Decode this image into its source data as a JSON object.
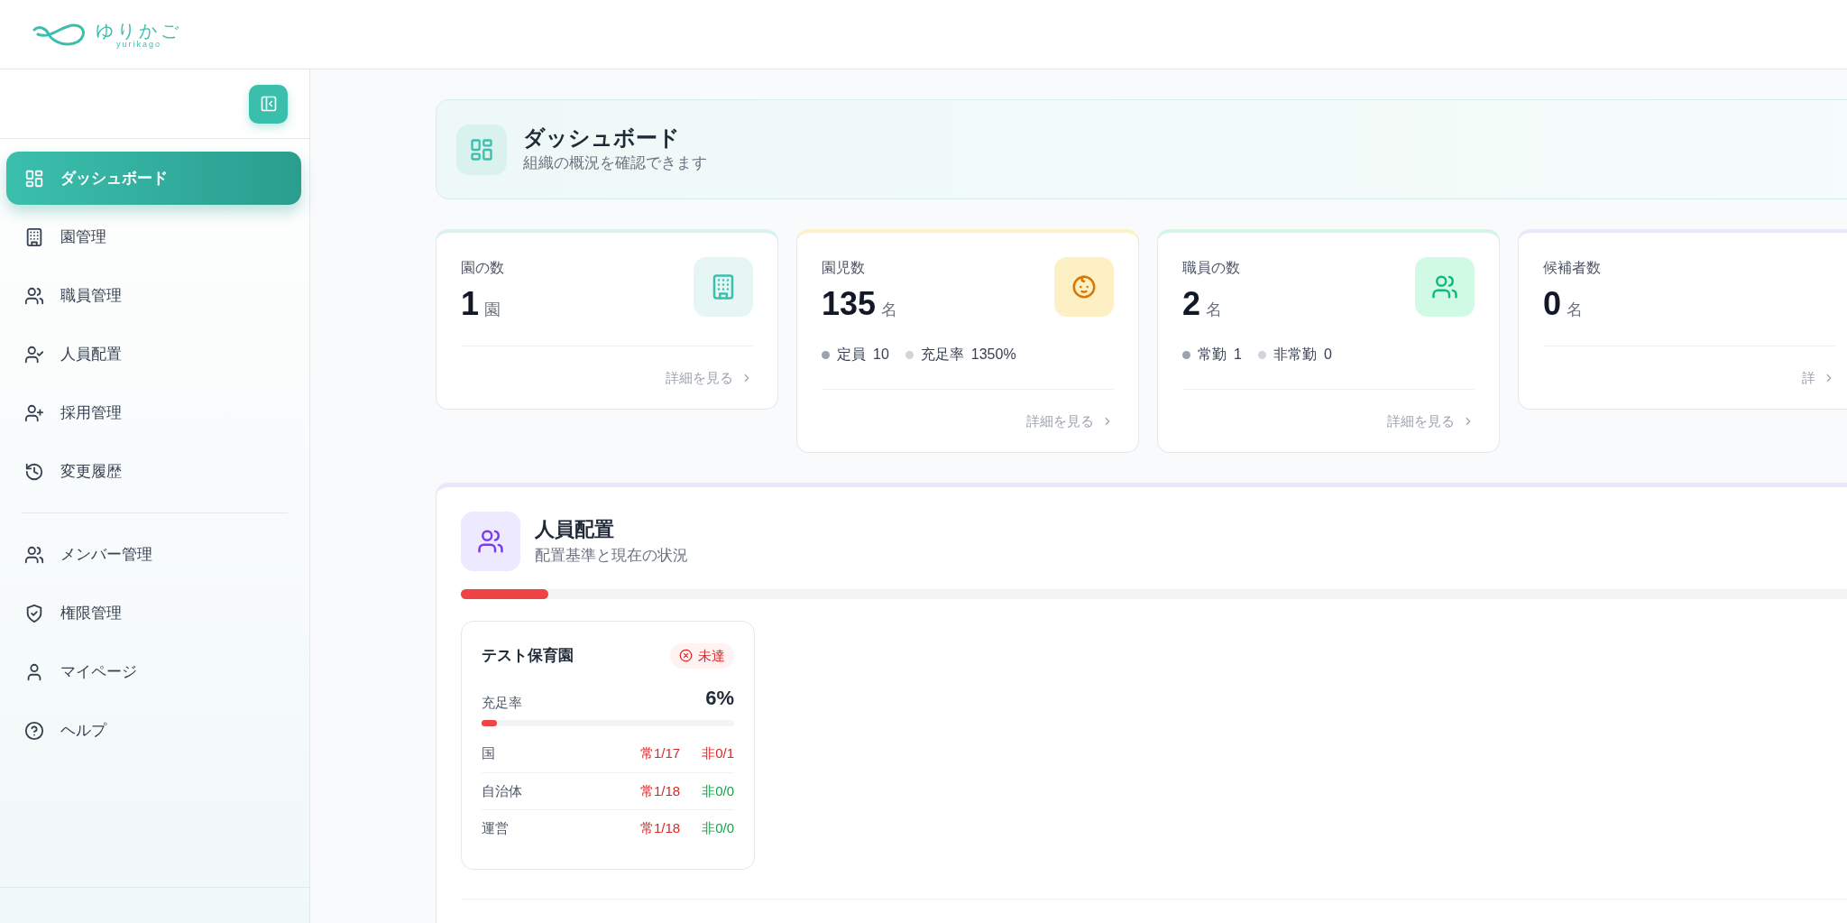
{
  "logo": {
    "name": "ゆりかご",
    "subtitle": "yurikago"
  },
  "sidebar": {
    "groups": [
      {
        "items": [
          {
            "label": "ダッシュボード",
            "selected": true
          },
          {
            "label": "園管理",
            "selected": false
          },
          {
            "label": "職員管理",
            "selected": false
          },
          {
            "label": "人員配置",
            "selected": false
          },
          {
            "label": "採用管理",
            "selected": false
          },
          {
            "label": "変更履歴",
            "selected": false
          }
        ]
      },
      {
        "items": [
          {
            "label": "メンバー管理",
            "selected": false
          },
          {
            "label": "権限管理",
            "selected": false
          },
          {
            "label": "マイページ",
            "selected": false
          },
          {
            "label": "ヘルプ",
            "selected": false
          }
        ]
      }
    ]
  },
  "page_header": {
    "title": "ダッシュボード",
    "subtitle": "組織の概況を確認できます"
  },
  "stat_cards": [
    {
      "label": "園の数",
      "value": "1",
      "unit": "園",
      "color": "#d8f3ef",
      "link": "詳細を見る"
    },
    {
      "label": "園児数",
      "value": "135",
      "unit": "名",
      "color": "#fdf1c7",
      "details": [
        {
          "label": "定員",
          "value": "10",
          "color": "#9ca3af"
        },
        {
          "label": "充足率",
          "value": "1350%",
          "color": "#d1d5db"
        }
      ],
      "link": "詳細を見る"
    },
    {
      "label": "職員の数",
      "value": "2",
      "unit": "名",
      "color": "#d5f5e3",
      "details": [
        {
          "label": "常勤",
          "value": "1",
          "color": "#9ca3af"
        },
        {
          "label": "非常勤",
          "value": "0",
          "color": "#d1d5db"
        }
      ],
      "link": "詳細を見る"
    },
    {
      "label": "候補者数",
      "value": "0",
      "unit": "名",
      "color": "#ebe7fb",
      "link": "詳"
    }
  ],
  "staffing": {
    "title": "人員配置",
    "subtitle": "配置基準と現在の状況",
    "level": 0.06,
    "facilities": [
      {
        "name": "テスト保育園",
        "status": {
          "label": "未達",
          "met": false
        },
        "rate_label": "充足率",
        "rate": "6%",
        "level": 0.06,
        "rows": [
          {
            "label": "国",
            "full_time": {
              "text": "常1/17",
              "met": false
            },
            "part_time": {
              "text": "非0/1",
              "met": false
            }
          },
          {
            "label": "自治体",
            "full_time": {
              "text": "常1/18",
              "met": false
            },
            "part_time": {
              "text": "非0/0",
              "met": true
            }
          },
          {
            "label": "運営",
            "full_time": {
              "text": "常1/18",
              "met": false
            },
            "part_time": {
              "text": "非0/0",
              "met": true
            }
          }
        ]
      }
    ]
  }
}
